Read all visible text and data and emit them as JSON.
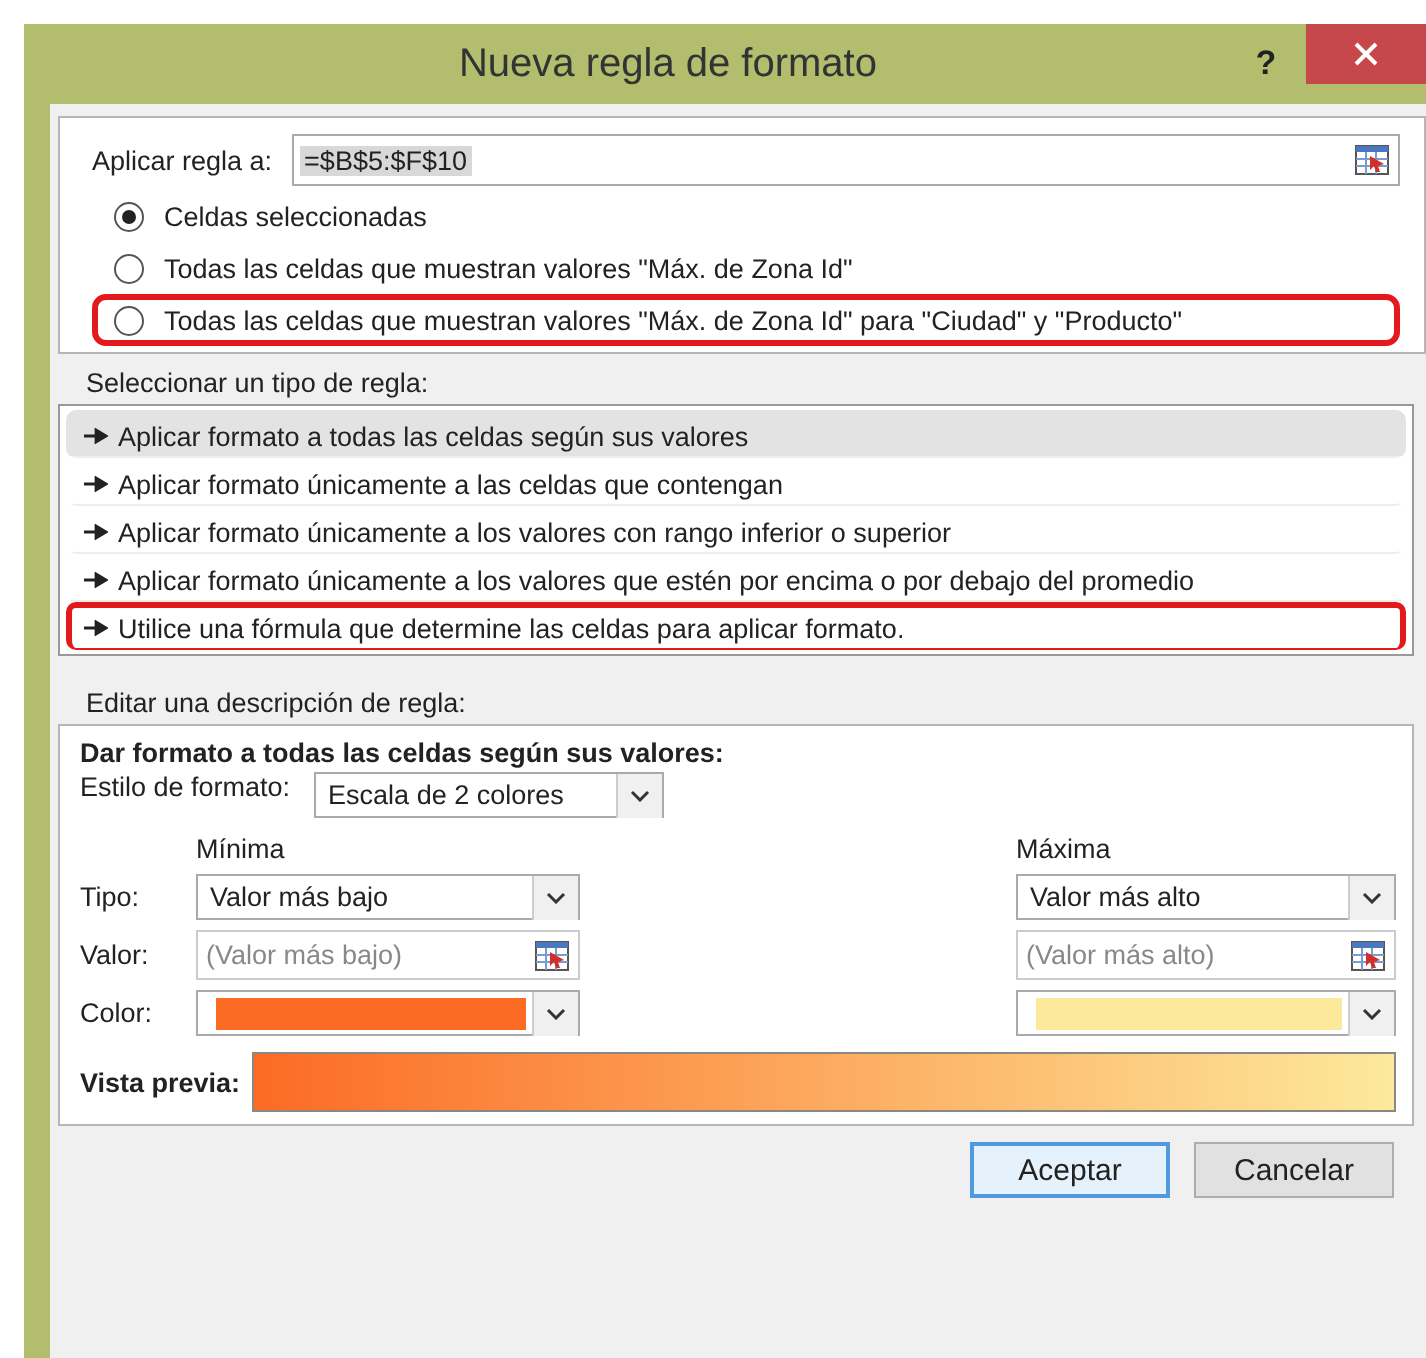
{
  "window": {
    "title": "Nueva regla de formato",
    "help": "?"
  },
  "apply_to": {
    "label": "Aplicar regla a:",
    "value": "=$B$5:$F$10"
  },
  "scope_options": [
    {
      "label": "Celdas seleccionadas",
      "selected": true,
      "highlighted": false
    },
    {
      "label": "Todas las celdas que muestran valores \"Máx. de Zona Id\"",
      "selected": false,
      "highlighted": false
    },
    {
      "label": "Todas las celdas que muestran valores \"Máx. de Zona Id\" para \"Ciudad\" y \"Producto\"",
      "selected": false,
      "highlighted": true
    }
  ],
  "rule_types": {
    "label": "Seleccionar un tipo de regla:",
    "items": [
      {
        "label": "Aplicar formato a todas las celdas según sus valores",
        "selected": true,
        "highlighted": false
      },
      {
        "label": "Aplicar formato únicamente a las celdas que contengan",
        "selected": false,
        "highlighted": false
      },
      {
        "label": "Aplicar formato únicamente a los valores con rango inferior o superior",
        "selected": false,
        "highlighted": false
      },
      {
        "label": "Aplicar formato únicamente a los valores que estén por encima o por debajo del promedio",
        "selected": false,
        "highlighted": false
      },
      {
        "label": "Utilice una fórmula que determine las celdas para aplicar formato.",
        "selected": false,
        "highlighted": true
      }
    ]
  },
  "description": {
    "label": "Editar una descripción de regla:",
    "heading": "Dar formato a todas las celdas según sus valores:",
    "style": {
      "label": "Estilo de formato:",
      "value": "Escala de 2 colores"
    },
    "row_labels": [
      "Tipo:",
      "Valor:",
      "Color:"
    ],
    "minimum": {
      "title": "Mínima",
      "type": "Valor más bajo",
      "placeholder": "(Valor más bajo)",
      "color": "#fc6b24"
    },
    "maximum": {
      "title": "Máxima",
      "type": "Valor más alto",
      "placeholder": "(Valor más alto)",
      "color": "#fde99b"
    },
    "preview_label": "Vista previa:"
  },
  "buttons": [
    {
      "label": "Aceptar",
      "default": true
    },
    {
      "label": "Cancelar",
      "default": false
    }
  ]
}
